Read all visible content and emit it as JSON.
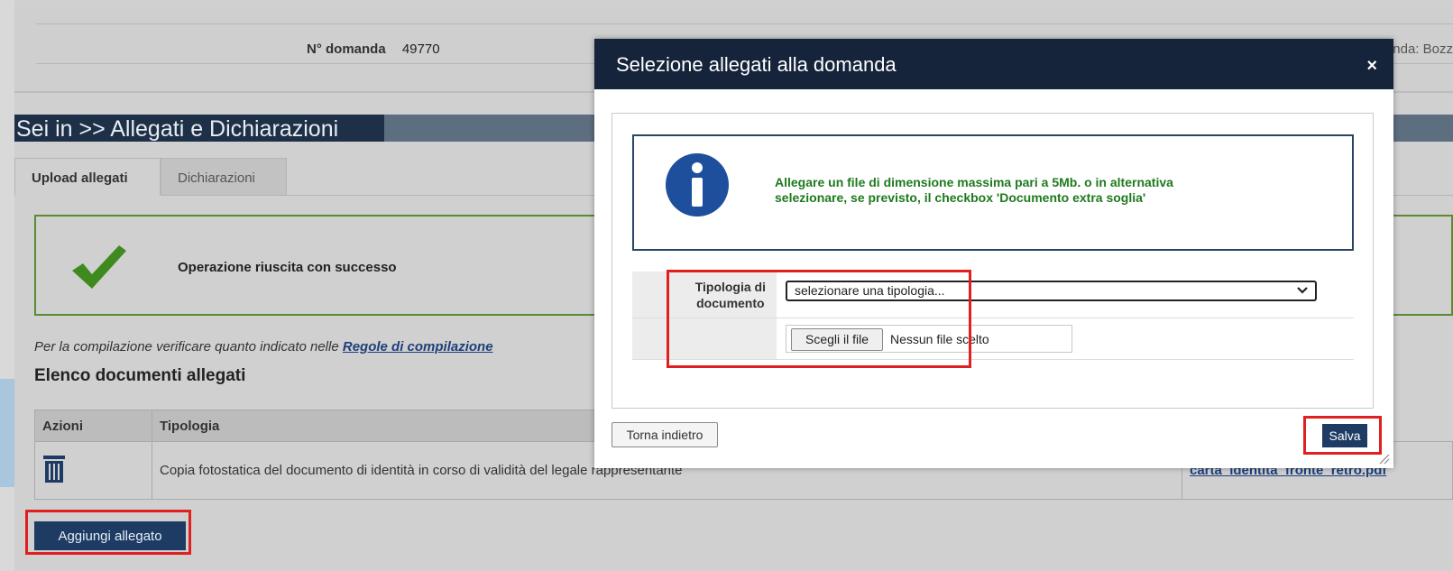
{
  "header": {
    "domanda_label": "N° domanda",
    "domanda_value": "49770",
    "stato_partial": "Stato domanda:  Bozz"
  },
  "section": {
    "breadcrumb": "Sei in >> Allegati e Dichiarazioni"
  },
  "tabs": [
    {
      "label": "Upload allegati",
      "active": true
    },
    {
      "label": "Dichiarazioni",
      "active": false
    }
  ],
  "success": {
    "message": "Operazione riuscita con successo",
    "icon": "checkmark-icon"
  },
  "rules": {
    "text": "Per la compilazione verificare quanto indicato nelle ",
    "link": "Regole di compilazione"
  },
  "documents": {
    "title": "Elenco documenti allegati",
    "columns": [
      "Azioni",
      "Tipologia"
    ],
    "rows": [
      {
        "action_icon": "trash-icon",
        "tipologia": "Copia fotostatica del documento di identità in corso di validità del legale rappresentante",
        "file": "carta_identita_fronte_retro.pdf"
      }
    ]
  },
  "add_button": "Aggiungi allegato",
  "modal": {
    "title": "Selezione allegati alla domanda",
    "close": "×",
    "info_line1": "Allegare un file di dimensione massima pari a 5Mb. o in alternativa",
    "info_line2": "selezionare, se previsto, il checkbox 'Documento extra soglia'",
    "tipologia_label_1": "Tipologia di",
    "tipologia_label_2": "documento",
    "select_value": "selezionare una tipologia...",
    "file_button": "Scegli il file",
    "file_status": "Nessun file scelto",
    "back_button": "Torna indietro",
    "save_button": "Salva"
  },
  "colors": {
    "section_bar": "#1d3048",
    "primary_button": "#1d3b63",
    "success_border": "#5a8a32",
    "info_text": "#1e7a1e",
    "highlight": "#e02020"
  }
}
